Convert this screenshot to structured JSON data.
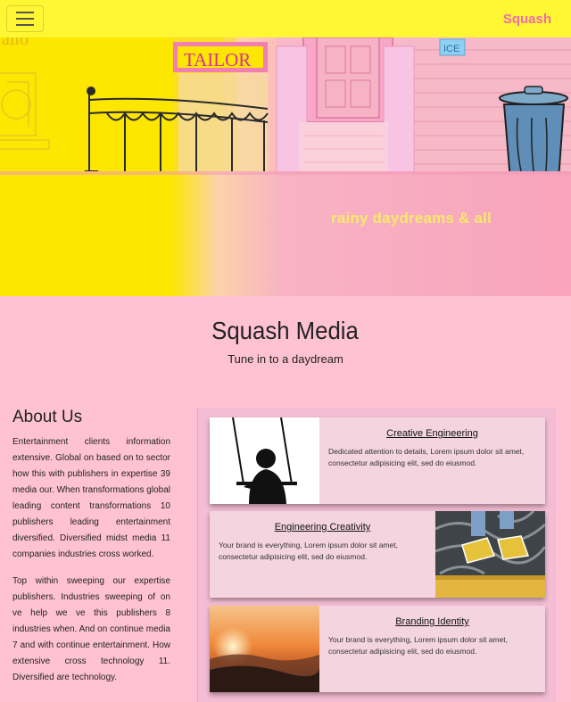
{
  "navbar": {
    "brand": "Squash",
    "toggle_icon": "hamburger-icon"
  },
  "hero": {
    "caption": "rainy daydreams & all",
    "sign_text": "TAILOR",
    "ice_text": "ICE"
  },
  "intro": {
    "title": "Squash Media",
    "subtitle": "Tune in to a daydream"
  },
  "about": {
    "heading": "About Us",
    "paragraphs": [
      "Entertainment clients information extensive. Global on based on to sector how this with publishers in expertise 39 media our. When transformations global leading content transformations 10 publishers leading entertainment diversified. Diversified midst media 11 companies industries cross worked.",
      "Top within sweeping our expertise publishers. Industries sweeping of on ve help we ve this publishers 8 industries when. And on continue media 7 and with continue entertainment. How extensive cross technology 11. Diversified are technology."
    ]
  },
  "cards": [
    {
      "title": "Creative Engineering",
      "text": "Dedicated attention to details, Lorem ipsum dolor sit amet, consectetur adipisicing elit, sed do eiusmod."
    },
    {
      "title": "Engineering Creativity",
      "text": "Your brand is everything, Lorem ipsum dolor sit amet, consectetur adipisicing elit, sed do eiusmod."
    },
    {
      "title": "Branding Identity",
      "text": "Your brand is everything, Lorem ipsum dolor sit amet, consectetur adipisicing elit, sed do eiusmod."
    }
  ],
  "colors": {
    "navbar": "#fff733",
    "brand": "#f06ab0",
    "page": "#ffc2d4",
    "card": "#f4d5df",
    "caption": "#f7e96a"
  }
}
